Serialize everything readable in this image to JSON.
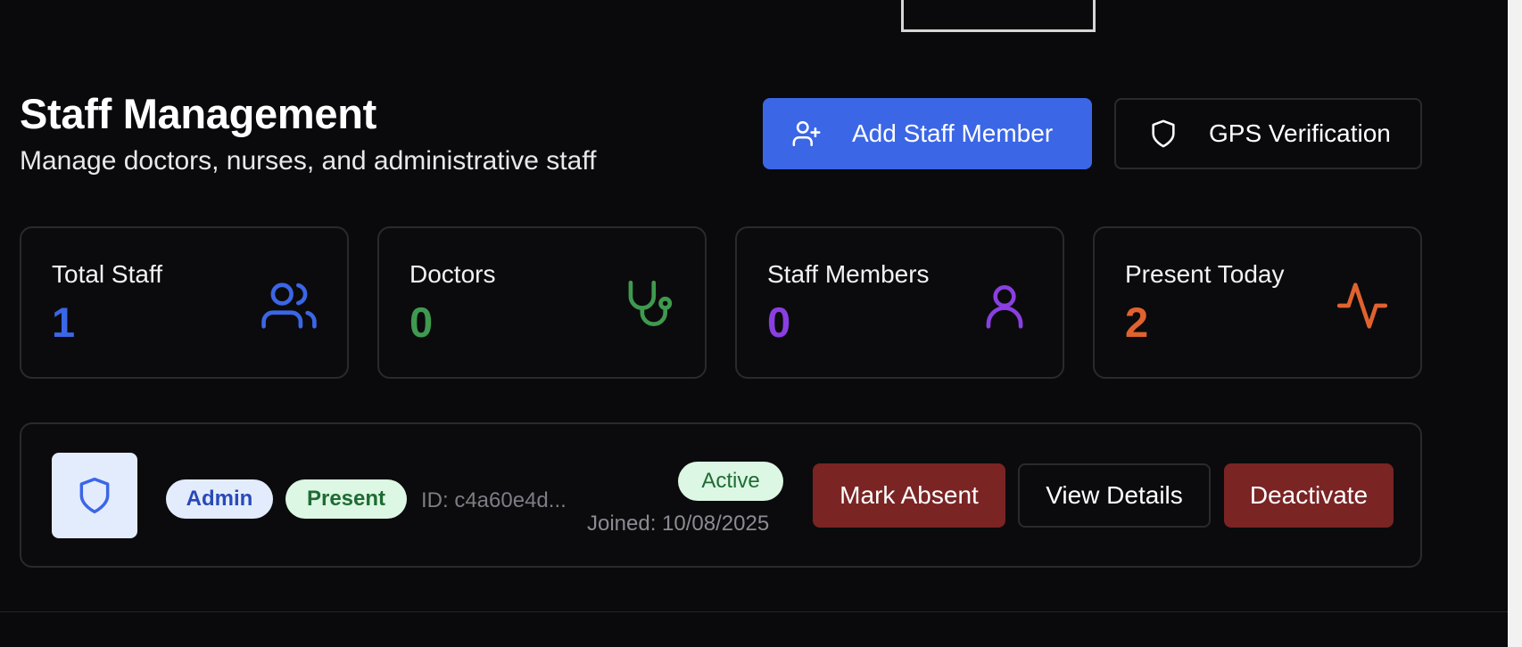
{
  "header": {
    "title": "Staff Management",
    "subtitle": "Manage doctors, nurses, and administrative staff",
    "add_button": {
      "label": "Add Staff Member",
      "icon": "user-plus-icon"
    },
    "gps_button": {
      "label": "GPS Verification",
      "icon": "shield-icon"
    }
  },
  "stats": [
    {
      "label": "Total Staff",
      "value": "1",
      "icon": "users-icon",
      "color": "#3b66e6"
    },
    {
      "label": "Doctors",
      "value": "0",
      "icon": "stethoscope-icon",
      "color": "#3f9a4f"
    },
    {
      "label": "Staff Members",
      "value": "0",
      "icon": "user-icon",
      "color": "#8a3fe0"
    },
    {
      "label": "Present Today",
      "value": "2",
      "icon": "activity-icon",
      "color": "#e0622f"
    }
  ],
  "staff_list": [
    {
      "avatar_icon": "shield-icon",
      "role_badge": "Admin",
      "attendance_badge": "Present",
      "id_text": "ID: c4a60e4d...",
      "status_badge": "Active",
      "joined": "Joined: 10/08/2025",
      "actions": {
        "mark_absent": "Mark Absent",
        "view_details": "View Details",
        "deactivate": "Deactivate"
      }
    }
  ],
  "colors": {
    "background": "#0a0a0c",
    "primary": "#3b66e6",
    "danger": "#7a2424"
  }
}
